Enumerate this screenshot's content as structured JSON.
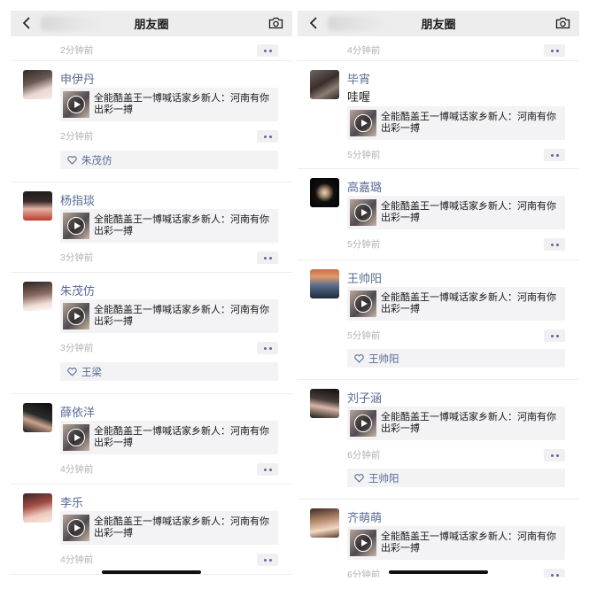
{
  "app": {
    "nav_title": "朋友圈",
    "share_title": "全能酷盖王一博喊话家乡新人：河南有你出彩一搏"
  },
  "left": {
    "top_time": "2分钟前",
    "posts": [
      {
        "name": "申伊丹",
        "time": "2分钟前",
        "likes": "朱茂仿"
      },
      {
        "name": "杨指琰",
        "time": "3分钟前"
      },
      {
        "name": "朱茂仿",
        "time": "3分钟前",
        "likes": "王梁"
      },
      {
        "name": "薛依洋",
        "time": "4分钟前"
      },
      {
        "name": "李乐",
        "time": "4分钟前"
      }
    ]
  },
  "right": {
    "top_time": "4分钟前",
    "posts": [
      {
        "name": "毕宵",
        "text": "哇喔",
        "time": "5分钟前"
      },
      {
        "name": "高嘉璐",
        "time": "5分钟前"
      },
      {
        "name": "王帅阳",
        "time": "5分钟前",
        "likes": "王帅阳"
      },
      {
        "name": "刘子涵",
        "time": "6分钟前",
        "likes": "王帅阳"
      },
      {
        "name": "齐萌萌",
        "time": "6分钟前"
      }
    ]
  },
  "colors": {
    "name_link": "#576b95",
    "navbar_bg": "#ededed",
    "card_bg": "#f3f3f5",
    "time_gray": "#b2b2b2"
  },
  "icons": {
    "back": "chevron-left-icon",
    "camera": "camera-icon",
    "play": "play-icon",
    "heart": "heart-outline-icon",
    "more": "more-dots-icon"
  }
}
